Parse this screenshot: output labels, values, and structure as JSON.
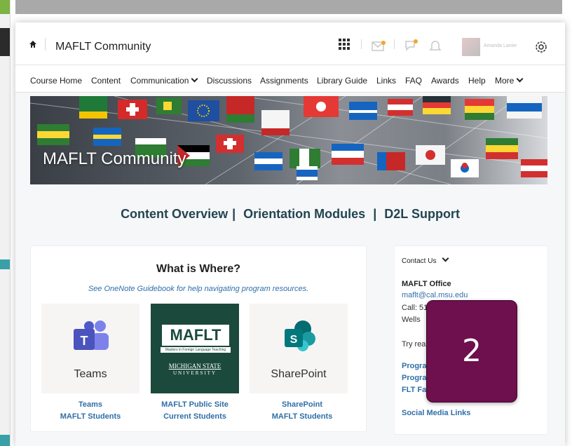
{
  "window": {
    "title": "MAFLT Community"
  },
  "menu": {
    "items": [
      "Course Home",
      "Content",
      "Communication",
      "Discussions",
      "Assignments",
      "Library Guide",
      "Links",
      "FAQ",
      "Awards",
      "Help",
      "More"
    ]
  },
  "user": {
    "name": "Amanda Lanier"
  },
  "banner": {
    "title": "MAFLT Community"
  },
  "links": {
    "content_overview": "Content Overview",
    "separator": "|",
    "orientation": "Orientation Modules",
    "separator2": "|",
    "support": "D2L Support"
  },
  "card": {
    "title": "What is Where?",
    "subtitle": "See OneNote Guidebook for help navigating program resources.",
    "tiles": [
      {
        "label": "Teams",
        "link1": "Teams",
        "link2": "MAFLT Students"
      },
      {
        "logo_text": "MAFLT",
        "logo_sub": "Masters in Foreign Language Teaching",
        "logo_univ1": "MICHIGAN STATE",
        "logo_univ2": "UNIVERSITY",
        "link1": "MAFLT Public Site",
        "link2": "Current Students"
      },
      {
        "label": "SharePoint",
        "link1": "SharePoint",
        "link2": "MAFLT Students"
      }
    ]
  },
  "contact": {
    "header": "Contact Us",
    "office": "MAFLT Office",
    "email": "maflt@cal.msu.edu",
    "call": "Call: 51",
    "wells": "Wells",
    "try": "Try rea",
    "prog1": "Progra",
    "prog2": "Progra",
    "flt": "FLT Fa",
    "social": "Social Media Links"
  },
  "badge": {
    "number": "2"
  },
  "colors": {
    "accent": "#2f6fa8",
    "badge": "#6e0f4e"
  }
}
